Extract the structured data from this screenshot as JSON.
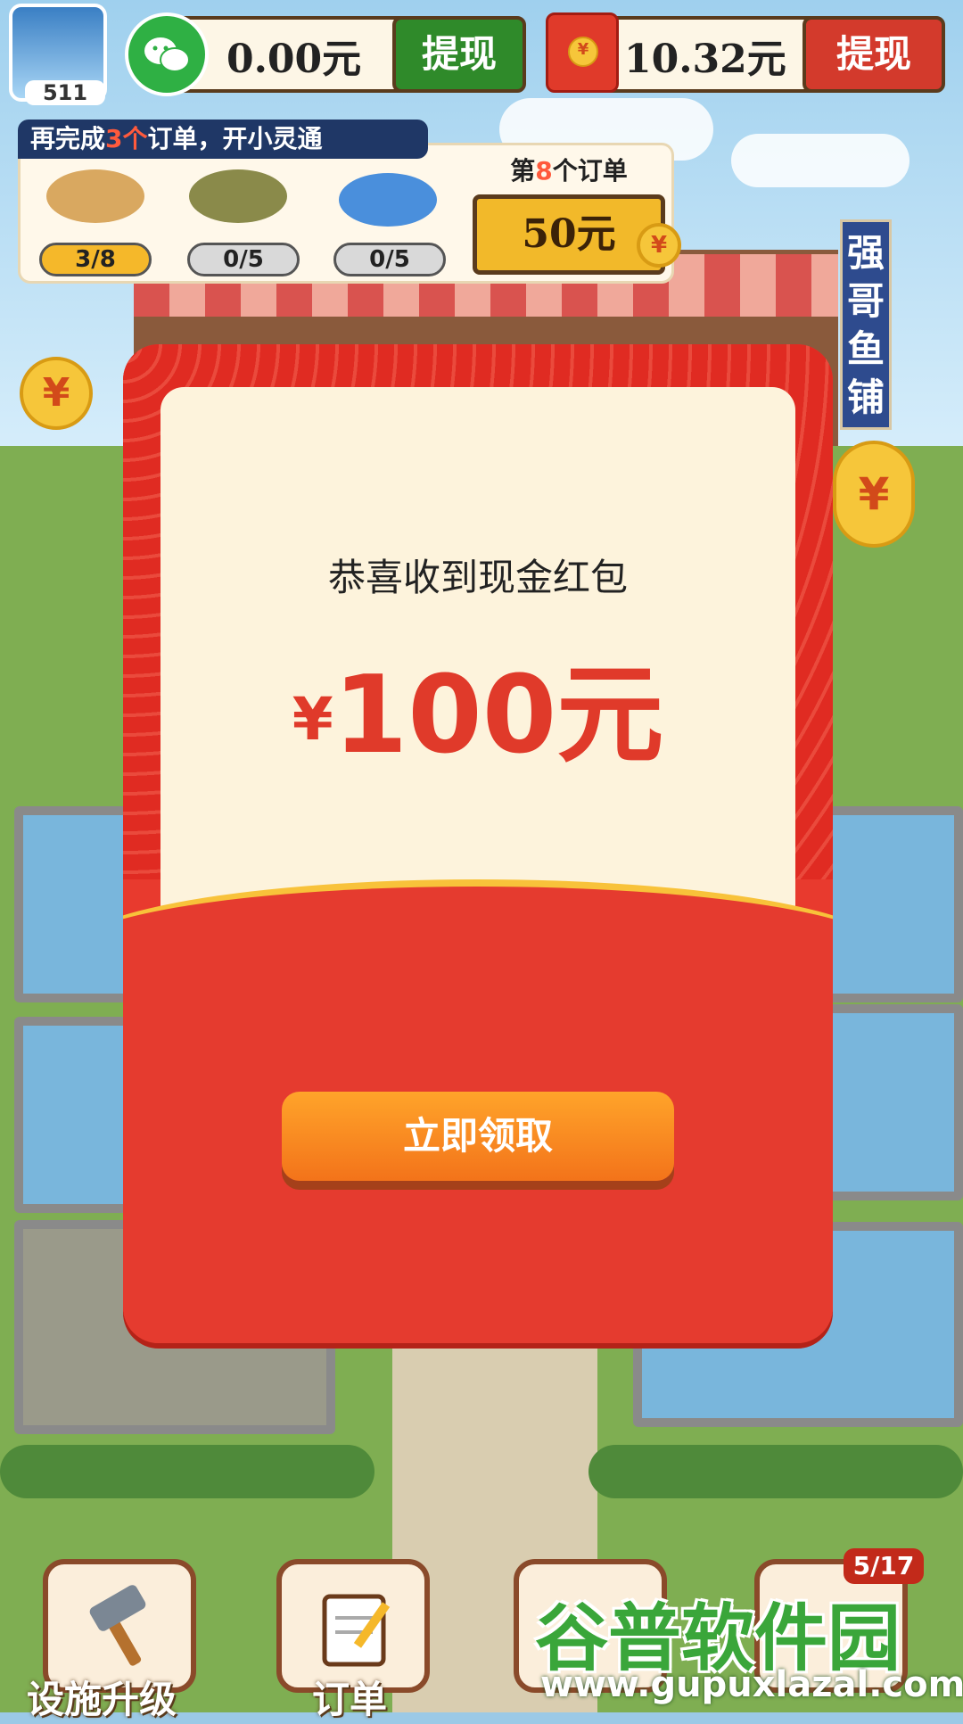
{
  "player": {
    "level": "511"
  },
  "wallet": {
    "wechat_amount": "0.00元",
    "wechat_withdraw_label": "提现",
    "redpacket_amount": "10.32元",
    "redpacket_withdraw_label": "提现"
  },
  "orders": {
    "banner_prefix": "再完成",
    "banner_highlight": "3个",
    "banner_suffix": "订单，开小灵通",
    "items": [
      {
        "progress": "3/8",
        "fish": "flatfish"
      },
      {
        "progress": "0/5",
        "fish": "grouper"
      },
      {
        "progress": "0/5",
        "fish": "blue-fish"
      }
    ],
    "next_prefix": "第",
    "next_highlight": "8",
    "next_suffix": "个订单",
    "reward": "50元"
  },
  "shop_sign": "强哥鱼铺",
  "modal": {
    "title": "恭喜收到现金红包",
    "currency": "¥",
    "amount": "100元",
    "claim_label": "立即领取"
  },
  "nav": {
    "upgrade_label": "设施升级",
    "orders_label": "订单",
    "badge": "5/17"
  },
  "watermark": {
    "title": "谷普软件园",
    "url": "www.gupuxlazal.com"
  },
  "colors": {
    "accent_red": "#e83a2e",
    "button_orange": "#f3731a",
    "wechat_green": "#2fb044"
  }
}
